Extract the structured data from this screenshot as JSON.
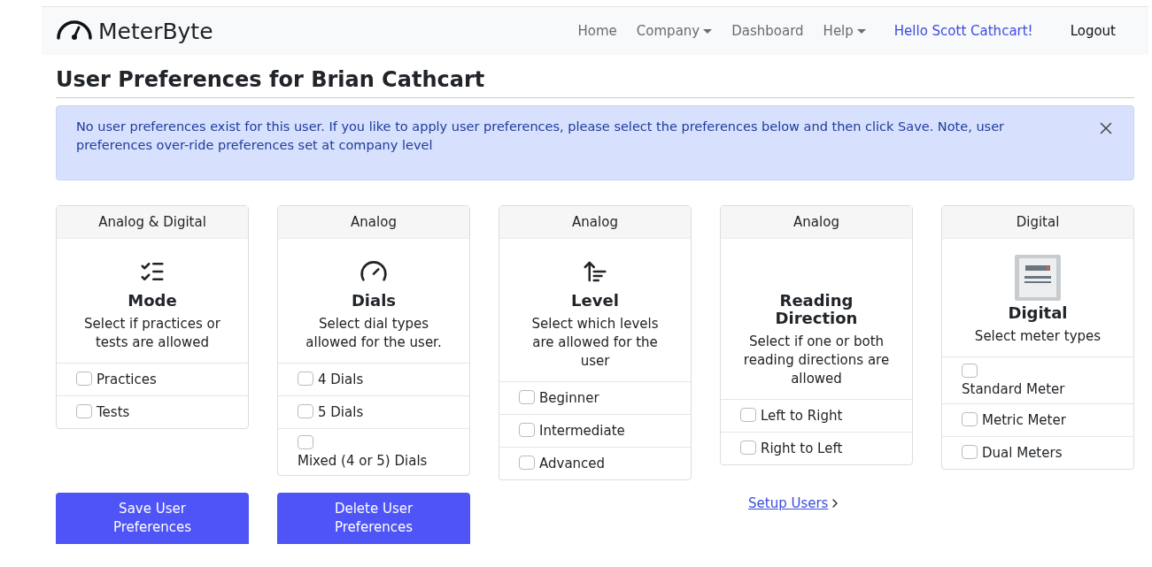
{
  "navbar": {
    "brand": "MeterByte",
    "links": [
      {
        "label": "Home",
        "dropdown": false
      },
      {
        "label": "Company",
        "dropdown": true
      },
      {
        "label": "Dashboard",
        "dropdown": false
      },
      {
        "label": "Help",
        "dropdown": true
      }
    ],
    "greeting": "Hello Scott Cathcart!",
    "logout": "Logout"
  },
  "page_title": "User Preferences for Brian Cathcart",
  "alert": {
    "message": "No user preferences exist for this user. If you like to apply user preferences, please select the preferences below and then click Save. Note, user preferences over-ride preferences set at company level"
  },
  "cards": [
    {
      "kind": "mode",
      "header": "Analog & Digital",
      "title": "Mode",
      "description": "Select if practices or tests are allowed",
      "options": [
        {
          "label": "Practices",
          "checked": false,
          "kind": "inline"
        },
        {
          "label": "Tests",
          "checked": false,
          "kind": "inline"
        }
      ]
    },
    {
      "kind": "dials",
      "header": "Analog",
      "title": "Dials",
      "description": "Select dial types allowed for the user.",
      "options": [
        {
          "label": "4 Dials",
          "checked": false,
          "kind": "inline"
        },
        {
          "label": "5 Dials",
          "checked": false,
          "kind": "inline"
        },
        {
          "label": "Mixed (4 or 5) Dials",
          "checked": false,
          "kind": "stacked"
        }
      ]
    },
    {
      "kind": "level",
      "header": "Analog",
      "title": "Level",
      "description": "Select which levels are allowed for the user",
      "options": [
        {
          "label": "Beginner",
          "checked": false,
          "kind": "inline"
        },
        {
          "label": "Intermediate",
          "checked": false,
          "kind": "inline"
        },
        {
          "label": "Advanced",
          "checked": false,
          "kind": "inline"
        }
      ]
    },
    {
      "kind": "direction",
      "header": "Analog",
      "title": "Reading Direction",
      "description": "Select if one or both reading directions are allowed",
      "options": [
        {
          "label": "Left to Right",
          "checked": false,
          "kind": "inline"
        },
        {
          "label": "Right to Left",
          "checked": false,
          "kind": "inline"
        }
      ]
    },
    {
      "kind": "meter",
      "header": "Digital",
      "title": "Digital",
      "description": "Select meter types",
      "options": [
        {
          "label": "Standard Meter",
          "checked": false,
          "kind": "stacked"
        },
        {
          "label": "Metric Meter",
          "checked": false,
          "kind": "inline"
        },
        {
          "label": "Dual Meters",
          "checked": false,
          "kind": "inline"
        }
      ]
    }
  ],
  "buttons": [
    {
      "label": "Save User Preferences"
    },
    {
      "label": "Delete User Preferences"
    }
  ],
  "setup_link": {
    "label": "Setup Users"
  }
}
